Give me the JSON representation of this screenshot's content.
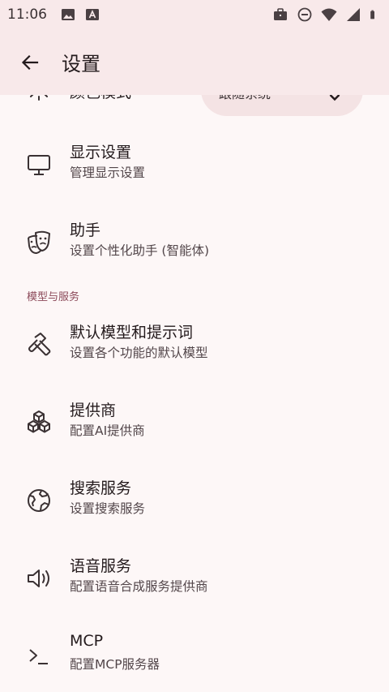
{
  "status_bar": {
    "time": "11:06",
    "left_icons": [
      "image-icon",
      "text-a-icon"
    ],
    "right_icons": [
      "briefcase-icon",
      "do-not-disturb-icon",
      "wifi-icon",
      "signal-icon",
      "battery-icon"
    ]
  },
  "app_bar": {
    "title": "设置",
    "back_icon": "arrow-back-icon"
  },
  "color_mode": {
    "label": "颜色模式",
    "value": "跟随系统",
    "icon": "sun-icon"
  },
  "display": {
    "title": "显示设置",
    "subtitle": "管理显示设置",
    "icon": "monitor-icon"
  },
  "assistant": {
    "title": "助手",
    "subtitle": "设置个性化助手 (智能体)",
    "icon": "theater-masks-icon"
  },
  "section_models": {
    "header": "模型与服务"
  },
  "default_models": {
    "title": "默认模型和提示词",
    "subtitle": "设置各个功能的默认模型",
    "icon": "hammer-icon"
  },
  "providers": {
    "title": "提供商",
    "subtitle": "配置AI提供商",
    "icon": "boxes-icon"
  },
  "search": {
    "title": "搜索服务",
    "subtitle": "设置搜索服务",
    "icon": "globe-icon"
  },
  "tts": {
    "title": "语音服务",
    "subtitle": "配置语音合成服务提供商",
    "icon": "speaker-icon"
  },
  "mcp": {
    "title": "MCP",
    "subtitle": "配置MCP服务器",
    "icon": "terminal-icon"
  },
  "colors": {
    "background": "#fdf7f7",
    "app_bar": "#f8e9ea",
    "section_header": "#8c4a5a",
    "select_bg": "#f4e3e4"
  }
}
